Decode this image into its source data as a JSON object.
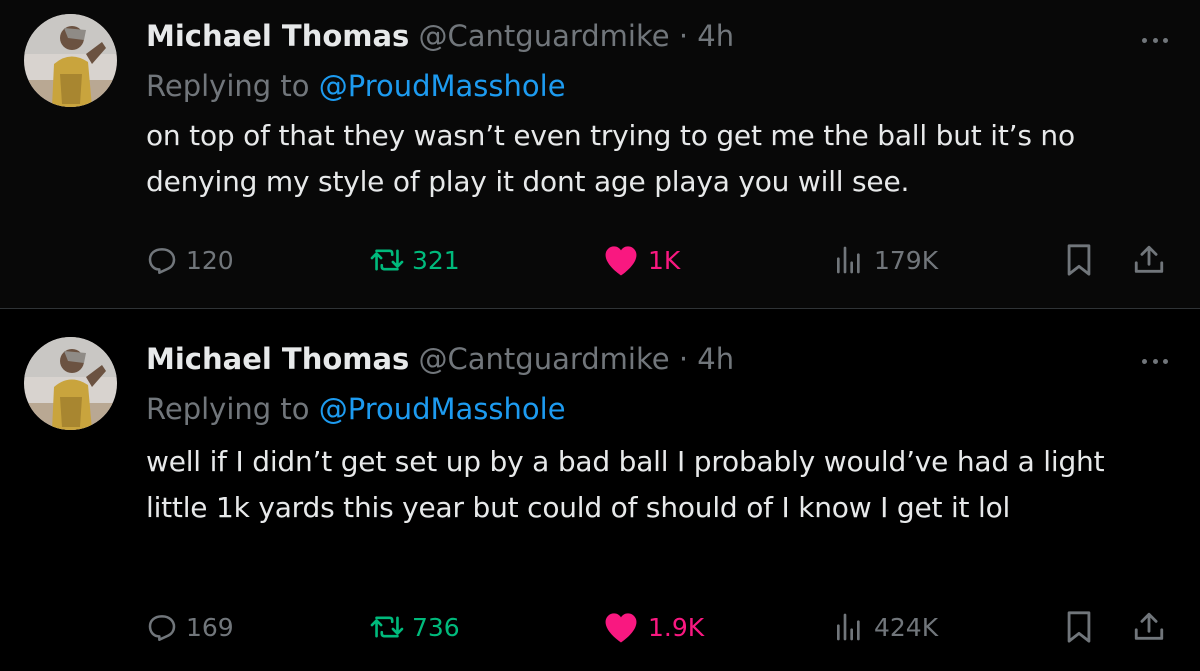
{
  "tweets": [
    {
      "author_name": "Michael Thomas",
      "handle": "@Cantguardmike",
      "separator": "·",
      "time": "4h",
      "replying_prefix": "Replying to",
      "replying_to": "@ProudMasshole",
      "text": "on top of that they wasn’t even trying to get me the ball but it’s no denying my style of play it dont age playa you will see.",
      "replies": "120",
      "retweets": "321",
      "likes": "1K",
      "views": "179K"
    },
    {
      "author_name": "Michael Thomas",
      "handle": "@Cantguardmike",
      "separator": "·",
      "time": "4h",
      "replying_prefix": "Replying to",
      "replying_to": "@ProudMasshole",
      "text": "well if I didn’t get set up by a bad ball I probably would’ve had a light little 1k yards this year but could of should of I know I get it lol",
      "replies": "169",
      "retweets": "736",
      "likes": "1.9K",
      "views": "424K"
    }
  ],
  "icons": {
    "reply": "reply-icon",
    "retweet": "retweet-icon",
    "like": "heart-icon",
    "views": "views-icon",
    "bookmark": "bookmark-icon",
    "share": "share-icon",
    "more": "more-icon"
  },
  "colors": {
    "background": "#000000",
    "text": "#e7e9ea",
    "muted": "#71767b",
    "link": "#1d9bf0",
    "retweet": "#00ba7c",
    "like": "#f91880"
  }
}
